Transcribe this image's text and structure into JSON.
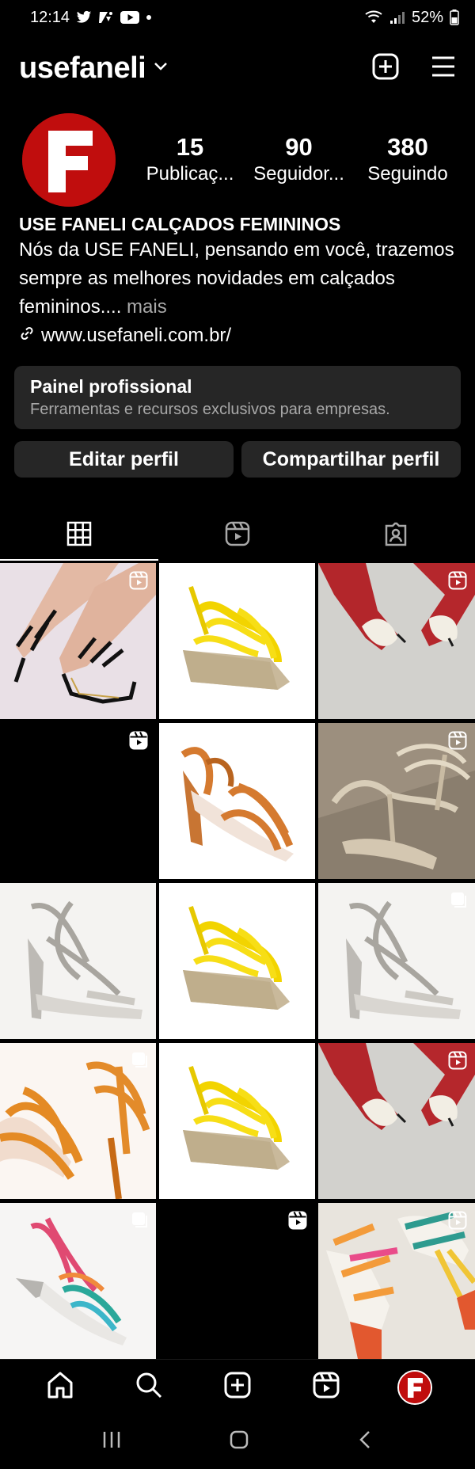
{
  "status_bar": {
    "time": "12:14",
    "battery": "52%",
    "icons": [
      "twitter-icon",
      "app-icon",
      "youtube-icon",
      "dot-icon",
      "wifi-icon",
      "signal-icon",
      "battery-icon"
    ]
  },
  "header": {
    "username": "usefaneli",
    "icons": [
      "chevron-down-icon",
      "create-post-icon",
      "menu-icon"
    ]
  },
  "profile": {
    "avatar_letter": "F",
    "stats": [
      {
        "value": "15",
        "label": "Publicaç..."
      },
      {
        "value": "90",
        "label": "Seguidor..."
      },
      {
        "value": "380",
        "label": "Seguindo"
      }
    ],
    "bio_name": "USE FANELI CALÇADOS FEMININOS",
    "bio_text": "Nós da USE FANELI, pensando em você, trazemos sempre as melhores novidades em calçados femininos....",
    "bio_more": " mais",
    "bio_link": "www.usefaneli.com.br/"
  },
  "pro_panel": {
    "title": "Painel profissional",
    "subtitle": "Ferramentas e recursos exclusivos para empresas."
  },
  "buttons": {
    "edit": "Editar perfil",
    "share": "Compartilhar perfil"
  },
  "tabs": [
    {
      "icon": "grid-icon",
      "active": true
    },
    {
      "icon": "reels-icon",
      "active": false
    },
    {
      "icon": "tagged-icon",
      "active": false
    }
  ],
  "posts": [
    {
      "subject": "black strappy sandals on foot",
      "badge": "reel-icon"
    },
    {
      "subject": "yellow espadrille wedge sandal",
      "badge": ""
    },
    {
      "subject": "red pumps with white bow",
      "badge": "reel-icon"
    },
    {
      "subject": "black video thumbnail",
      "badge": "reel-icon"
    },
    {
      "subject": "copper strappy heeled sandal",
      "badge": ""
    },
    {
      "subject": "glitter silver sandals",
      "badge": "reel-icon"
    },
    {
      "subject": "silver crisscross heeled sandal",
      "badge": ""
    },
    {
      "subject": "yellow espadrille wedge sandal",
      "badge": ""
    },
    {
      "subject": "silver crisscross heeled sandal",
      "badge": "multi-icon"
    },
    {
      "subject": "orange strappy sandals pair",
      "badge": "multi-icon"
    },
    {
      "subject": "yellow espadrille wedge sandal",
      "badge": "multi-icon"
    },
    {
      "subject": "red pumps with white bow",
      "badge": "reel-icon"
    },
    {
      "subject": "multicolor strappy sandal",
      "badge": "multi-icon"
    },
    {
      "subject": "black video thumbnail",
      "badge": "reel-icon"
    },
    {
      "subject": "colorful block heel sandals",
      "badge": "reel-icon"
    }
  ],
  "bottom_nav": [
    "home-icon",
    "search-icon",
    "create-icon",
    "reels-icon",
    "profile-avatar"
  ],
  "colors": {
    "background": "#000000",
    "panel": "#262626",
    "muted": "#a8a8a8",
    "brand_red": "#c00d0d"
  }
}
